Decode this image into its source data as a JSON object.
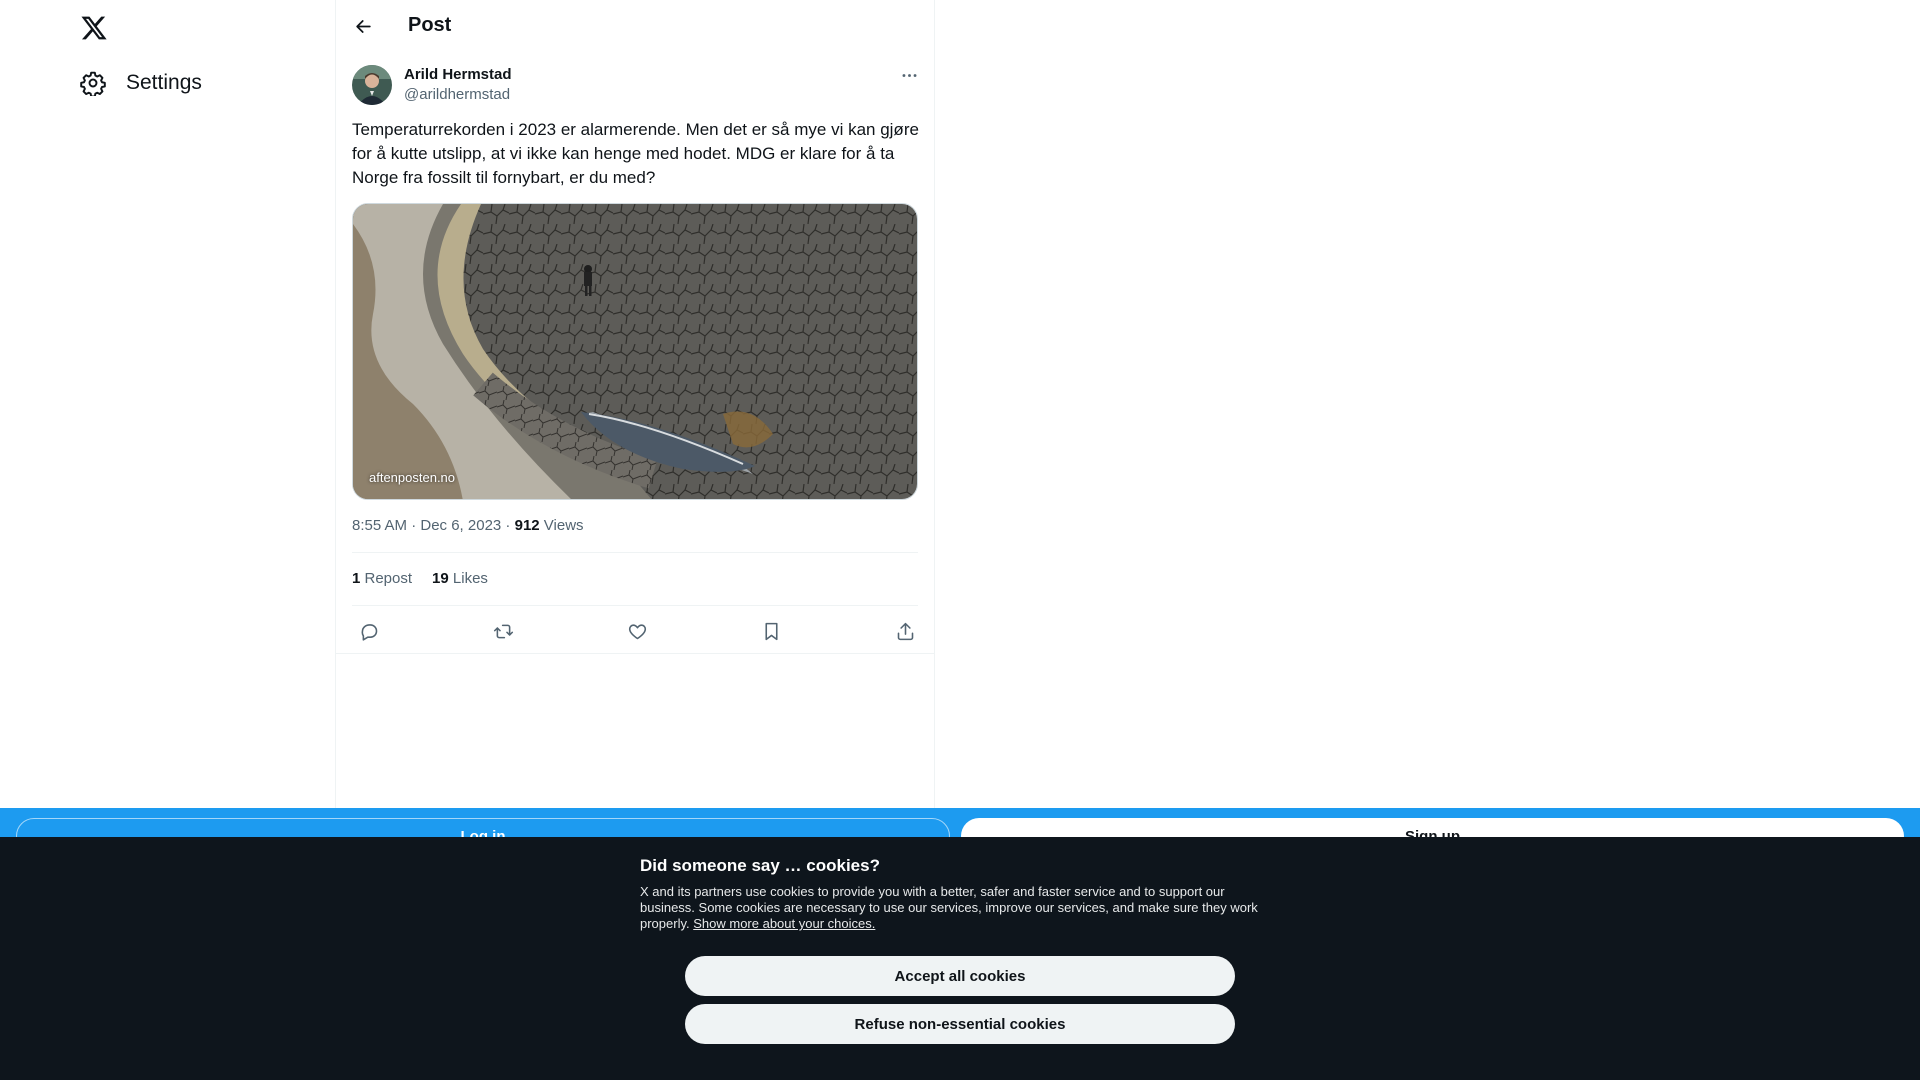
{
  "nav": {
    "logo_icon": "x-logo-icon",
    "settings_icon": "gear-icon",
    "settings_label": "Settings"
  },
  "header": {
    "back_icon": "arrow-left-icon",
    "title": "Post"
  },
  "post": {
    "author_name": "Arild Hermstad",
    "author_handle": "@arildhermstad",
    "more_icon": "ellipsis-icon",
    "text": "Temperaturrekorden i 2023 er alarmerende. Men det er så mye vi kan gjøre for å kutte utslipp, at vi ikke kan henge med hodet. MDG er klare for å ta Norge fra fossilt til fornybart, er du med?",
    "card_domain": "aftenposten.no",
    "timestamp": "8:55 AM · Dec 6, 2023",
    "separator": " · ",
    "views_count": "912",
    "views_label": " Views",
    "repost_count": "1",
    "repost_label": " Repost",
    "likes_count": "19",
    "likes_label": " Likes",
    "actions": [
      "reply-icon",
      "repost-icon",
      "like-icon",
      "bookmark-icon",
      "share-icon"
    ]
  },
  "bottom_bar": {
    "login_label": "Log in",
    "signup_label": "Sign up"
  },
  "cookie_banner": {
    "title": "Did someone say … cookies?",
    "body": "X and its partners use cookies to provide you with a better, safer and faster service and to support our business. Some cookies are necessary to use our services, improve our services, and make sure they work properly. ",
    "link": "Show more about your choices.",
    "accept_label": "Accept all cookies",
    "refuse_label": "Refuse non-essential cookies"
  },
  "colors": {
    "accent": "#1d9bf0",
    "text_primary": "#0f1419",
    "text_secondary": "#536471",
    "cookie_bg": "#0e151c"
  }
}
